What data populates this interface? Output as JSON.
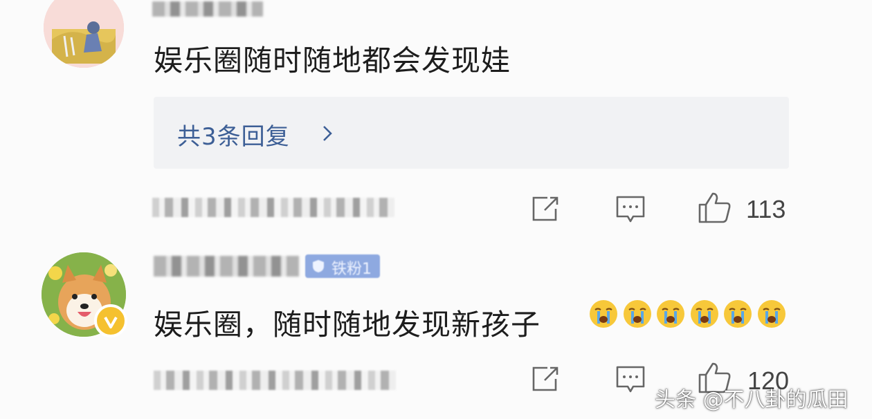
{
  "comments": [
    {
      "text": "娱乐圈随时随地都会发现娃",
      "reply_link": "共3条回复",
      "like_count": "113",
      "icons": [
        "avatar",
        "share-icon",
        "comment-icon",
        "like-icon",
        "chevron-right-icon"
      ]
    },
    {
      "text": "娱乐圈，随时随地发现新孩子",
      "badge": "铁粉1",
      "emoji_count": 6,
      "emoji": "crying-face-icon",
      "like_count": "120",
      "icons": [
        "avatar",
        "verified-badge-icon",
        "share-icon",
        "comment-icon",
        "like-icon"
      ]
    }
  ],
  "watermark": "头条 @不八卦的瓜田",
  "colors": {
    "link": "#3d5f96",
    "reply_bg": "#f1f2f4",
    "verified": "#f5c12f",
    "badge": "#8ea9e0"
  }
}
